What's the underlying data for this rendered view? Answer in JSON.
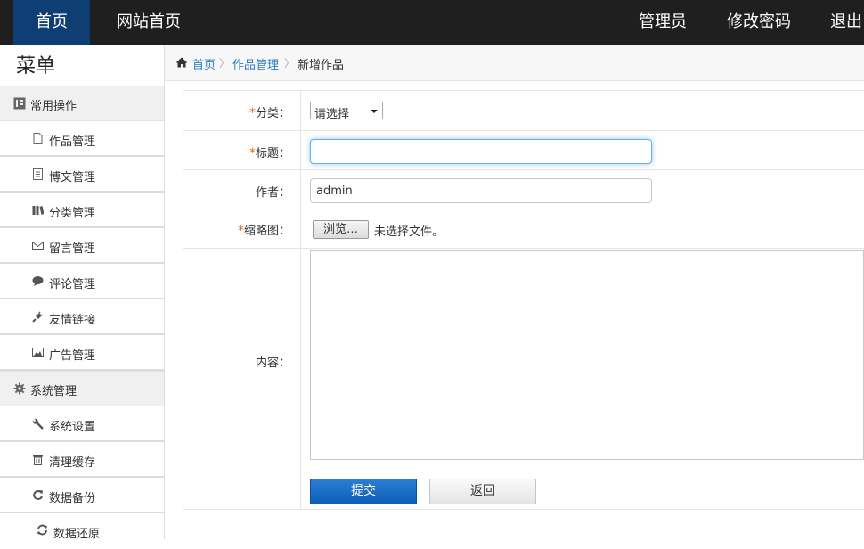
{
  "topnav": {
    "home": "首页",
    "site_home": "网站首页",
    "admin": "管理员",
    "change_password": "修改密码",
    "logout": "退出"
  },
  "sidebar": {
    "title": "菜单",
    "groups": [
      {
        "label": "常用操作",
        "icon": "list-icon",
        "items": [
          {
            "label": "作品管理",
            "icon": "file-icon"
          },
          {
            "label": "博文管理",
            "icon": "document-icon"
          },
          {
            "label": "分类管理",
            "icon": "books-icon"
          },
          {
            "label": "留言管理",
            "icon": "envelope-icon"
          },
          {
            "label": "评论管理",
            "icon": "comment-icon"
          },
          {
            "label": "友情链接",
            "icon": "plug-icon"
          },
          {
            "label": "广告管理",
            "icon": "picture-icon"
          }
        ]
      },
      {
        "label": "系统管理",
        "icon": "gear-icon",
        "items": [
          {
            "label": "系统设置",
            "icon": "wrench-icon"
          },
          {
            "label": "清理缓存",
            "icon": "trash-icon"
          },
          {
            "label": "数据备份",
            "icon": "refresh-icon"
          },
          {
            "label": "数据还原",
            "icon": "sync-icon"
          }
        ]
      }
    ]
  },
  "breadcrumb": {
    "home": "首页",
    "section": "作品管理",
    "current": "新增作品",
    "separator": "〉"
  },
  "form": {
    "required_mark": "*",
    "category_label": "分类：",
    "category_value": "请选择",
    "title_label": "标题：",
    "title_value": "",
    "author_label": "作者：",
    "author_value": "admin",
    "thumbnail_label": "缩略图：",
    "browse_label": "浏览…",
    "no_file_text": "未选择文件。",
    "content_label": "内容：",
    "submit_label": "提交",
    "back_label": "返回"
  },
  "colors": {
    "topbar_bg": "#1f1f1f",
    "active_tab": "#0e3e74",
    "link": "#2b7bc0",
    "required": "#e4691b",
    "primary_button": "#1a6dc4"
  }
}
